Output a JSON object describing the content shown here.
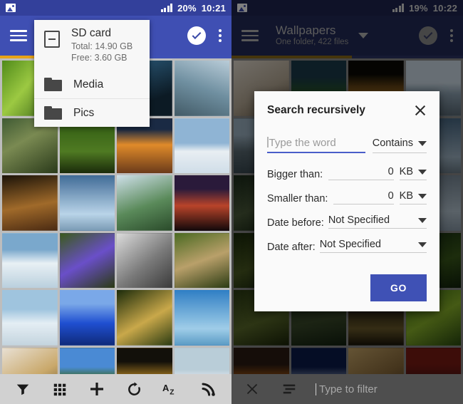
{
  "left_panel": {
    "status": {
      "image_icon": "image-icon",
      "signal_icon": "signal-bars-icon",
      "battery": "20%",
      "time": "10:21"
    },
    "appbar": {
      "menu_icon": "hamburger-menu-icon",
      "check_icon": "select-all-check-icon",
      "overflow_icon": "overflow-menu-icon"
    },
    "dropdown": {
      "storage_icon": "sd-card-icon",
      "title": "SD card",
      "total": "Total: 14.90 GB",
      "free": "Free: 3.60 GB",
      "items": [
        {
          "icon": "folder-icon",
          "label": "Media"
        },
        {
          "icon": "folder-icon",
          "label": "Pics"
        }
      ]
    },
    "toolbar": [
      {
        "icon": "filter-funnel-icon",
        "label": "Filter"
      },
      {
        "icon": "grid-view-icon",
        "label": "Grid view"
      },
      {
        "icon": "plus-add-icon",
        "label": "Add"
      },
      {
        "icon": "refresh-icon",
        "label": "Refresh"
      },
      {
        "icon": "sort-az-icon",
        "label": "Sort A-Z"
      },
      {
        "icon": "wifi-signal-icon",
        "label": "Network"
      }
    ],
    "accent_colors": [
      "#e8a317",
      "#3f51b5"
    ],
    "tiles": [
      "#6ca02a",
      "#2f4a64",
      "#17344a",
      "#8fa7b5",
      "#5a6b52",
      "#3d5a1e",
      "#c9752a",
      "#cfdde8",
      "#6b4a22",
      "#405a78",
      "#7a9aa8",
      "#2a1f3a",
      "#4a6e8a",
      "#5b3fa0",
      "#8f8f8f",
      "#6f7a3a",
      "#9fb8cc",
      "#2b5fd1",
      "#4a4a16",
      "#3b7ec4",
      "#cbbba4",
      "#4a6b2f",
      "#3a2a0a",
      "#b9cdd8"
    ]
  },
  "right_panel": {
    "status": {
      "image_icon": "image-icon",
      "signal_icon": "signal-bars-icon",
      "battery": "19%",
      "time": "10:22"
    },
    "appbar": {
      "menu_icon": "hamburger-menu-icon",
      "title": "Wallpapers",
      "subtitle": "One folder, 422 files",
      "caret_icon": "chevron-down-icon",
      "check_icon": "select-all-check-icon",
      "overflow_icon": "overflow-menu-icon"
    },
    "accent_colors": [
      "#9a7318",
      "#2d3566"
    ],
    "tiles": [
      "#cfc6b8",
      "#2a3a22",
      "#120e06",
      "#9aa8b4",
      "#5a6a72",
      "#4a3f2a",
      "#7a0f12",
      "#6a7a86",
      "#2a3a2a",
      "#1a2a3a",
      "#0a1a3a",
      "#8a9aa8",
      "#2a3a1a",
      "#3a4a2a",
      "#5a3a1a",
      "#1a3a1a",
      "#3a4a22",
      "#2a3a2a",
      "#4a3a22",
      "#4a6a1a",
      "#6a3a12",
      "#1a2a4a",
      "#8a6a3a",
      "#4a1a12"
    ],
    "bottombar": {
      "close_icon": "close-x-icon",
      "sort_icon": "sort-lines-icon",
      "filter_placeholder": "Type to filter"
    }
  },
  "dialog": {
    "title": "Search recursively",
    "close_icon": "close-x-icon",
    "word": {
      "placeholder": "Type the word",
      "value": ""
    },
    "match_mode": {
      "value": "Contains",
      "caret_icon": "chevron-down-icon"
    },
    "bigger_than": {
      "label": "Bigger than:",
      "value": "0",
      "unit": "KB",
      "caret_icon": "chevron-down-icon"
    },
    "smaller_than": {
      "label": "Smaller than:",
      "value": "0",
      "unit": "KB",
      "caret_icon": "chevron-down-icon"
    },
    "date_before": {
      "label": "Date before:",
      "value": "Not Specified",
      "caret_icon": "chevron-down-icon"
    },
    "date_after": {
      "label": "Date after:",
      "value": "Not Specified",
      "caret_icon": "chevron-down-icon"
    },
    "go_button": "GO",
    "accent_color": "#3f51b5"
  }
}
